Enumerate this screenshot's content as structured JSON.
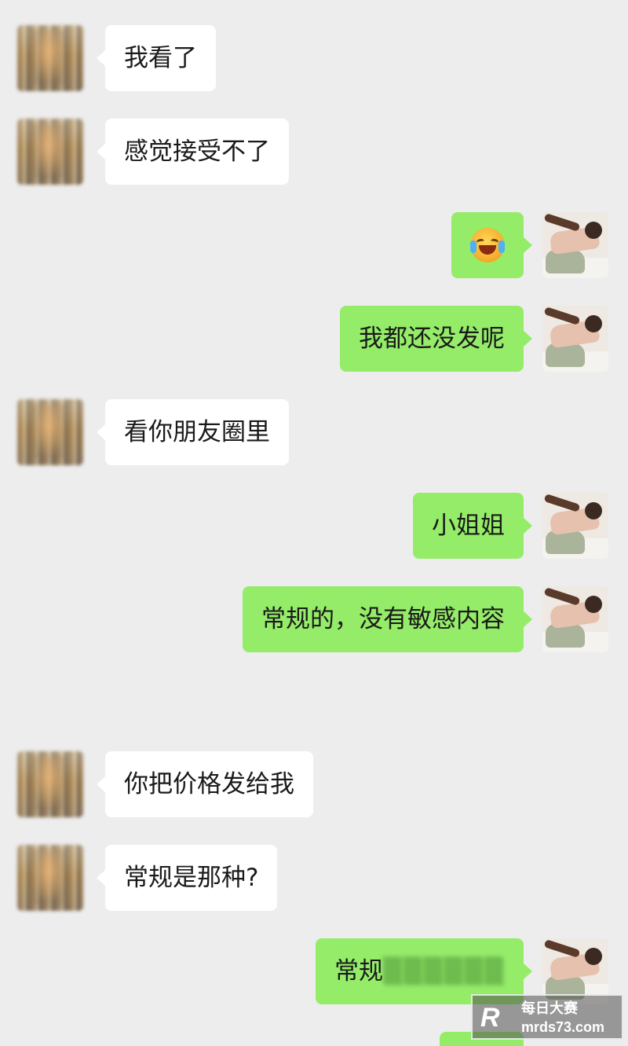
{
  "messages": [
    {
      "side": "left",
      "text": "我看了"
    },
    {
      "side": "left",
      "text": "感觉接受不了"
    },
    {
      "side": "right",
      "emoji": "loudly-crying-face"
    },
    {
      "side": "right",
      "text": "我都还没发呢"
    },
    {
      "side": "left",
      "text": "看你朋友圈里"
    },
    {
      "side": "right",
      "text": "小姐姐"
    },
    {
      "side": "right",
      "text": "常规的，没有敏感内容"
    },
    {
      "side": "left",
      "text": "你把价格发给我"
    },
    {
      "side": "left",
      "text": "常规是那种?"
    },
    {
      "side": "right",
      "text": "常规",
      "redacted_hint": "▒▒▒▒▒▒"
    }
  ],
  "watermark": {
    "logo": "R",
    "title": "每日大赛",
    "url": "mrds73.com"
  },
  "colors": {
    "background": "#ededed",
    "incoming_bubble": "#ffffff",
    "outgoing_bubble": "#95ec69"
  }
}
